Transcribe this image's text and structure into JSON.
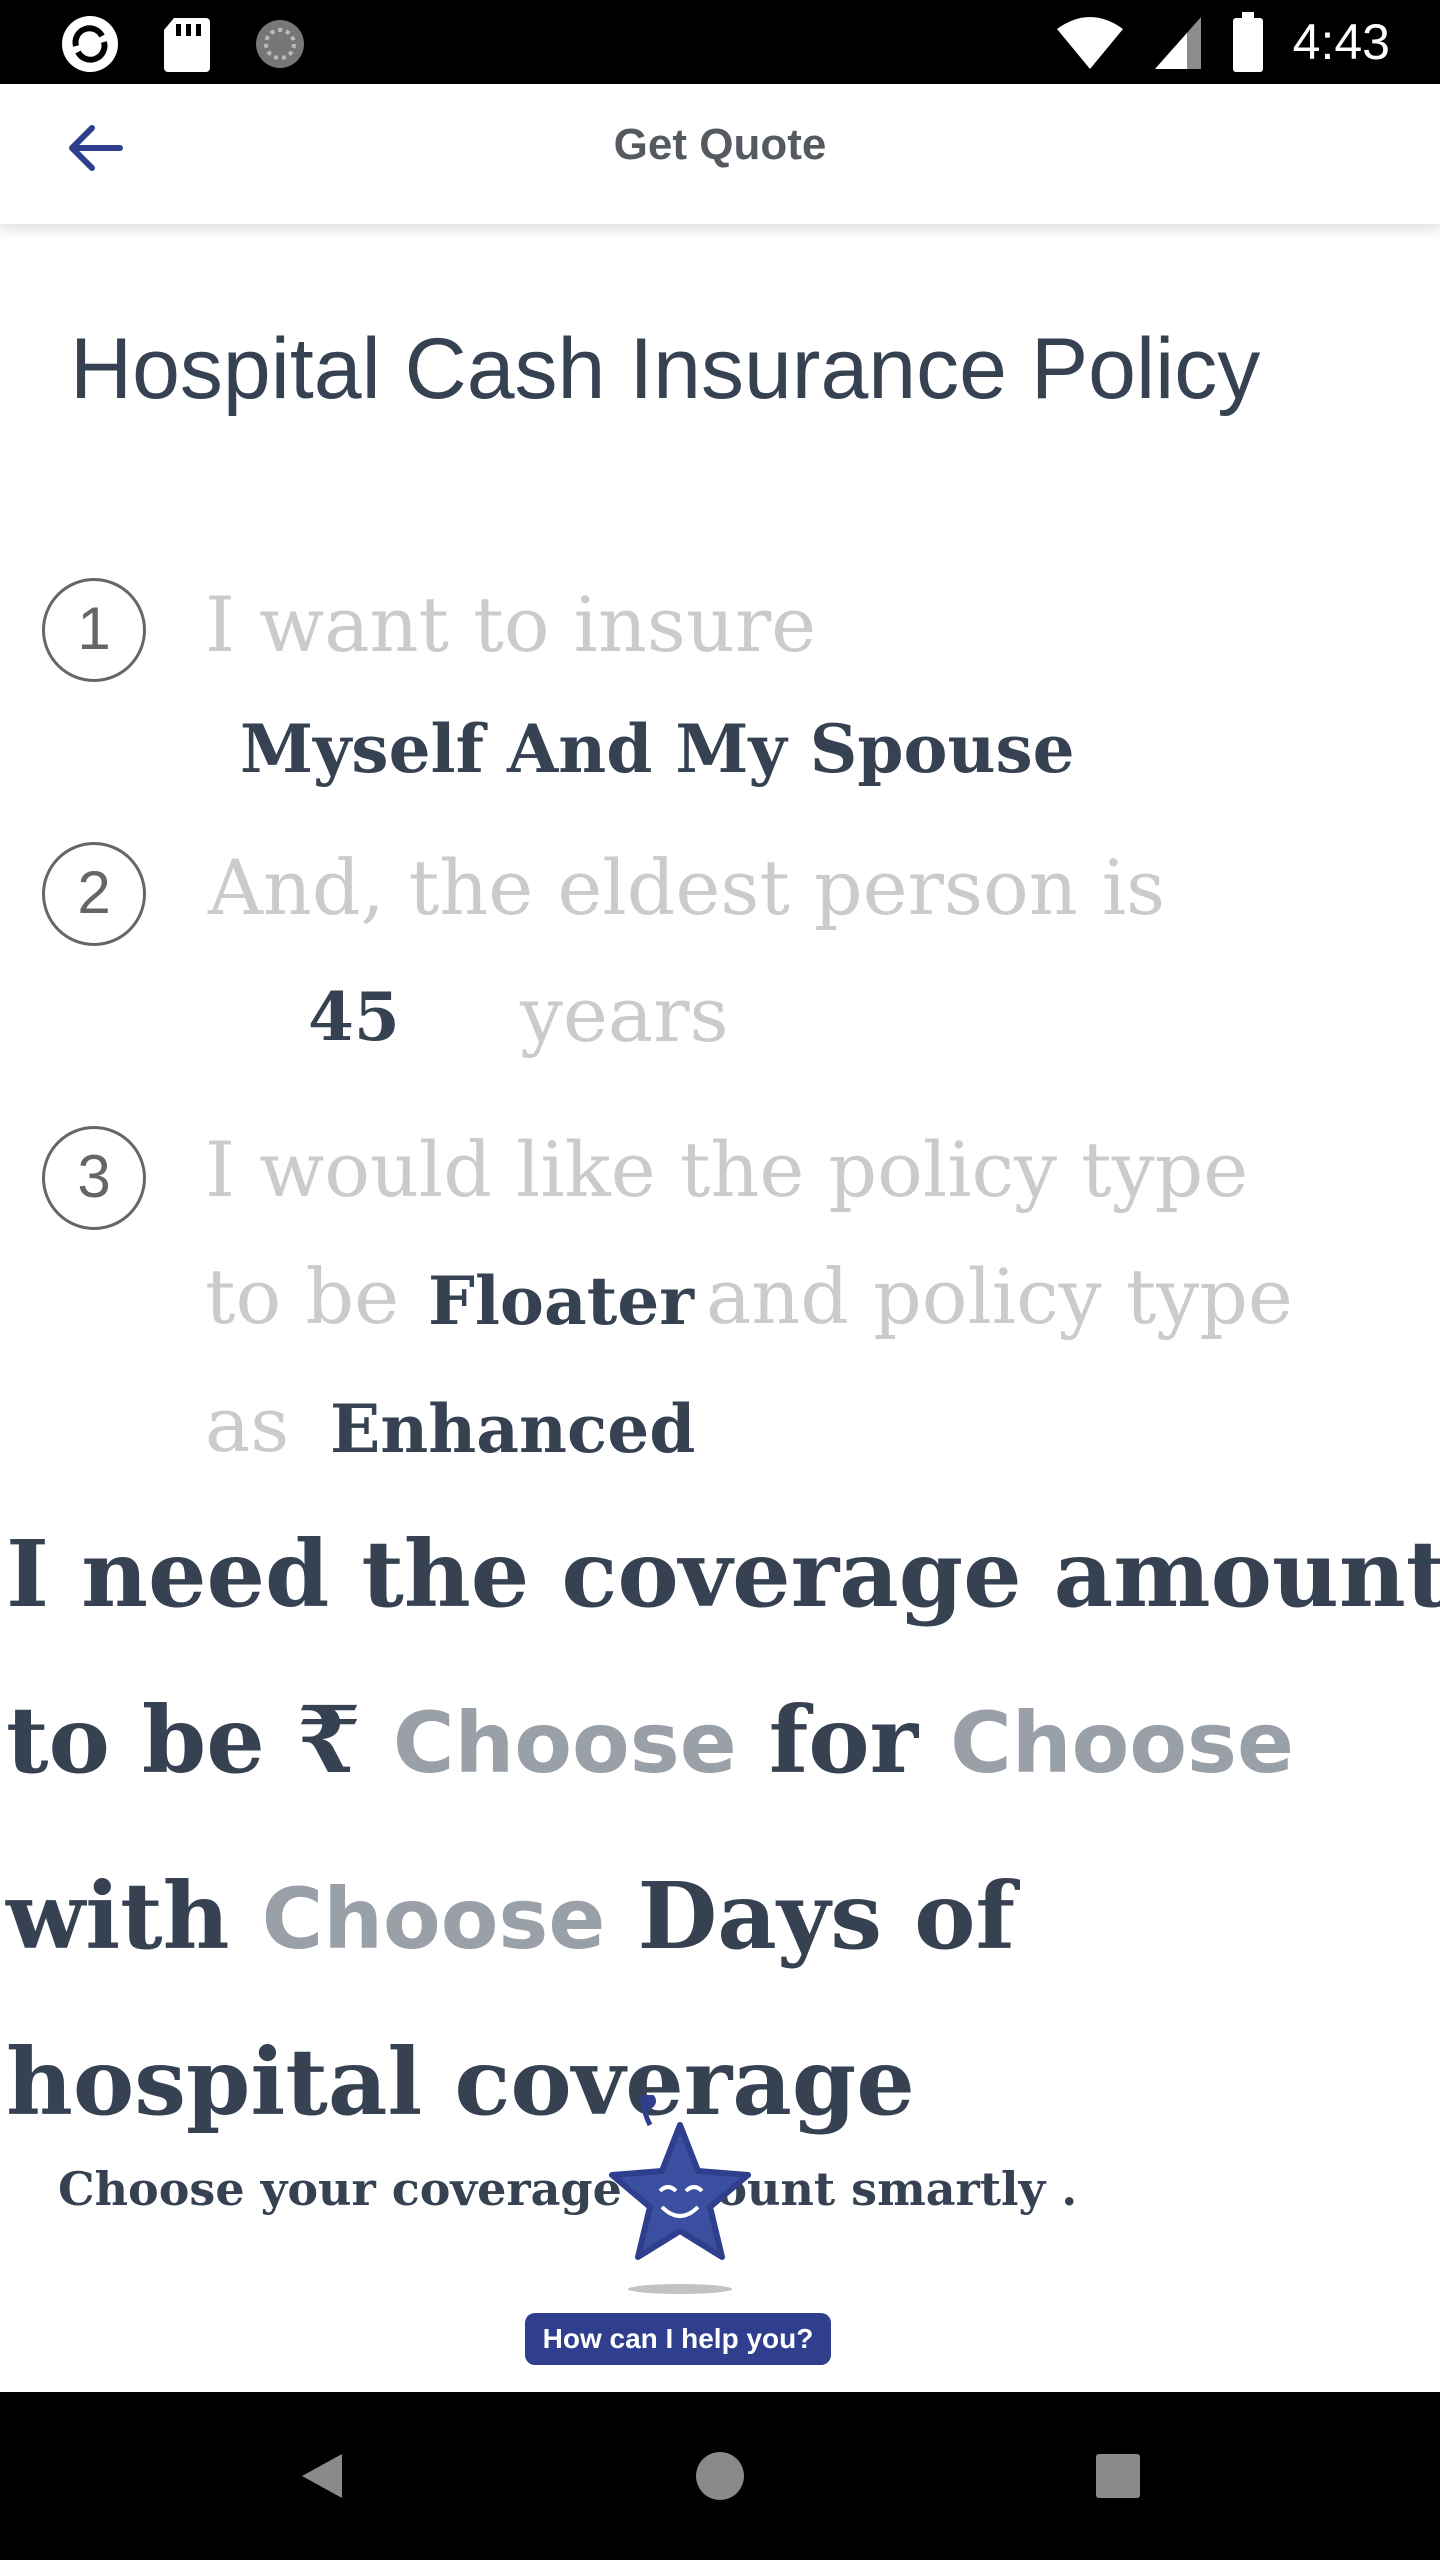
{
  "status_bar": {
    "time": "4:43",
    "left_icons": [
      "app-notification-icon",
      "sd-card-icon",
      "sync-icon"
    ],
    "right_icons": [
      "wifi-icon",
      "signal-icon",
      "battery-icon"
    ]
  },
  "app_bar": {
    "title": "Get Quote",
    "back_icon": "arrow-left-icon",
    "accent_color": "#2f3f8d"
  },
  "page": {
    "title": "Hospital Cash Insurance Policy"
  },
  "steps": [
    {
      "number": "1",
      "prompt": "I want to insure",
      "value": "Myself And My Spouse"
    },
    {
      "number": "2",
      "prompt": "And, the eldest person is",
      "value": "45",
      "suffix": "years"
    },
    {
      "number": "3",
      "prompt_line1": "I would like the policy type",
      "prompt_line2_a": "to be",
      "policy_type": "Floater",
      "prompt_line2_b": "and policy type",
      "prompt_line3": "as",
      "plan_type": "Enhanced"
    }
  ],
  "coverage": {
    "line1": "I need the coverage amount",
    "line2_a": "to be ₹",
    "amount_choice": "Choose",
    "line2_b": "for",
    "term_choice": "Choose",
    "line3_a": "with",
    "days_choice": "Choose",
    "line3_b": "Days of",
    "line4": "hospital coverage",
    "hint": "Choose your coverage amount smartly ."
  },
  "assistant": {
    "label": "How can I help you?",
    "icon": "star-mascot-icon"
  },
  "nav_bar": {
    "icons": [
      "back-triangle-icon",
      "home-circle-icon",
      "recents-square-icon"
    ]
  }
}
